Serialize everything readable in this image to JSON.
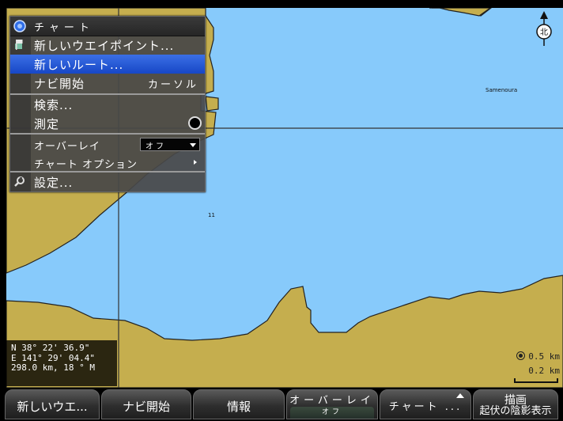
{
  "map": {
    "place_label": "Samenoura",
    "depth_label": "11",
    "colors": {
      "water": "#87cafb",
      "land": "#c5ae4e",
      "coast": "#222222",
      "grid": "#333333"
    }
  },
  "compass": {
    "label": "北"
  },
  "menu": {
    "title": "チャート",
    "items": [
      {
        "label": "新しいウエイポイント...",
        "icon": "waypoint-flag-icon"
      },
      {
        "label": "新しいルート...",
        "selected": true
      },
      {
        "label": "ナビ開始",
        "shortcut": "カーソル"
      },
      {
        "label": "検索..."
      },
      {
        "label": "測定",
        "icon": "radio-dot-icon"
      },
      {
        "label": "オーバーレイ",
        "value": "オフ"
      },
      {
        "label": "チャート オプション"
      },
      {
        "label": "設定...",
        "icon": "wrench-icon"
      }
    ]
  },
  "coords": {
    "lat": "N  38° 22' 36.9\"",
    "lon": "E 141° 29' 04.4\"",
    "range": "298.0 km, 18 ° M"
  },
  "scale": {
    "zoom": "0.5 km",
    "bar": "0.2 km"
  },
  "softkeys": [
    {
      "label": "新しいウエ..."
    },
    {
      "label": "ナビ開始"
    },
    {
      "label": "情報"
    },
    {
      "label": "オーバーレイ",
      "sub": "オフ"
    },
    {
      "label": "チャート ..."
    },
    {
      "label": "描画",
      "sub": "起伏の陰影表示"
    }
  ]
}
